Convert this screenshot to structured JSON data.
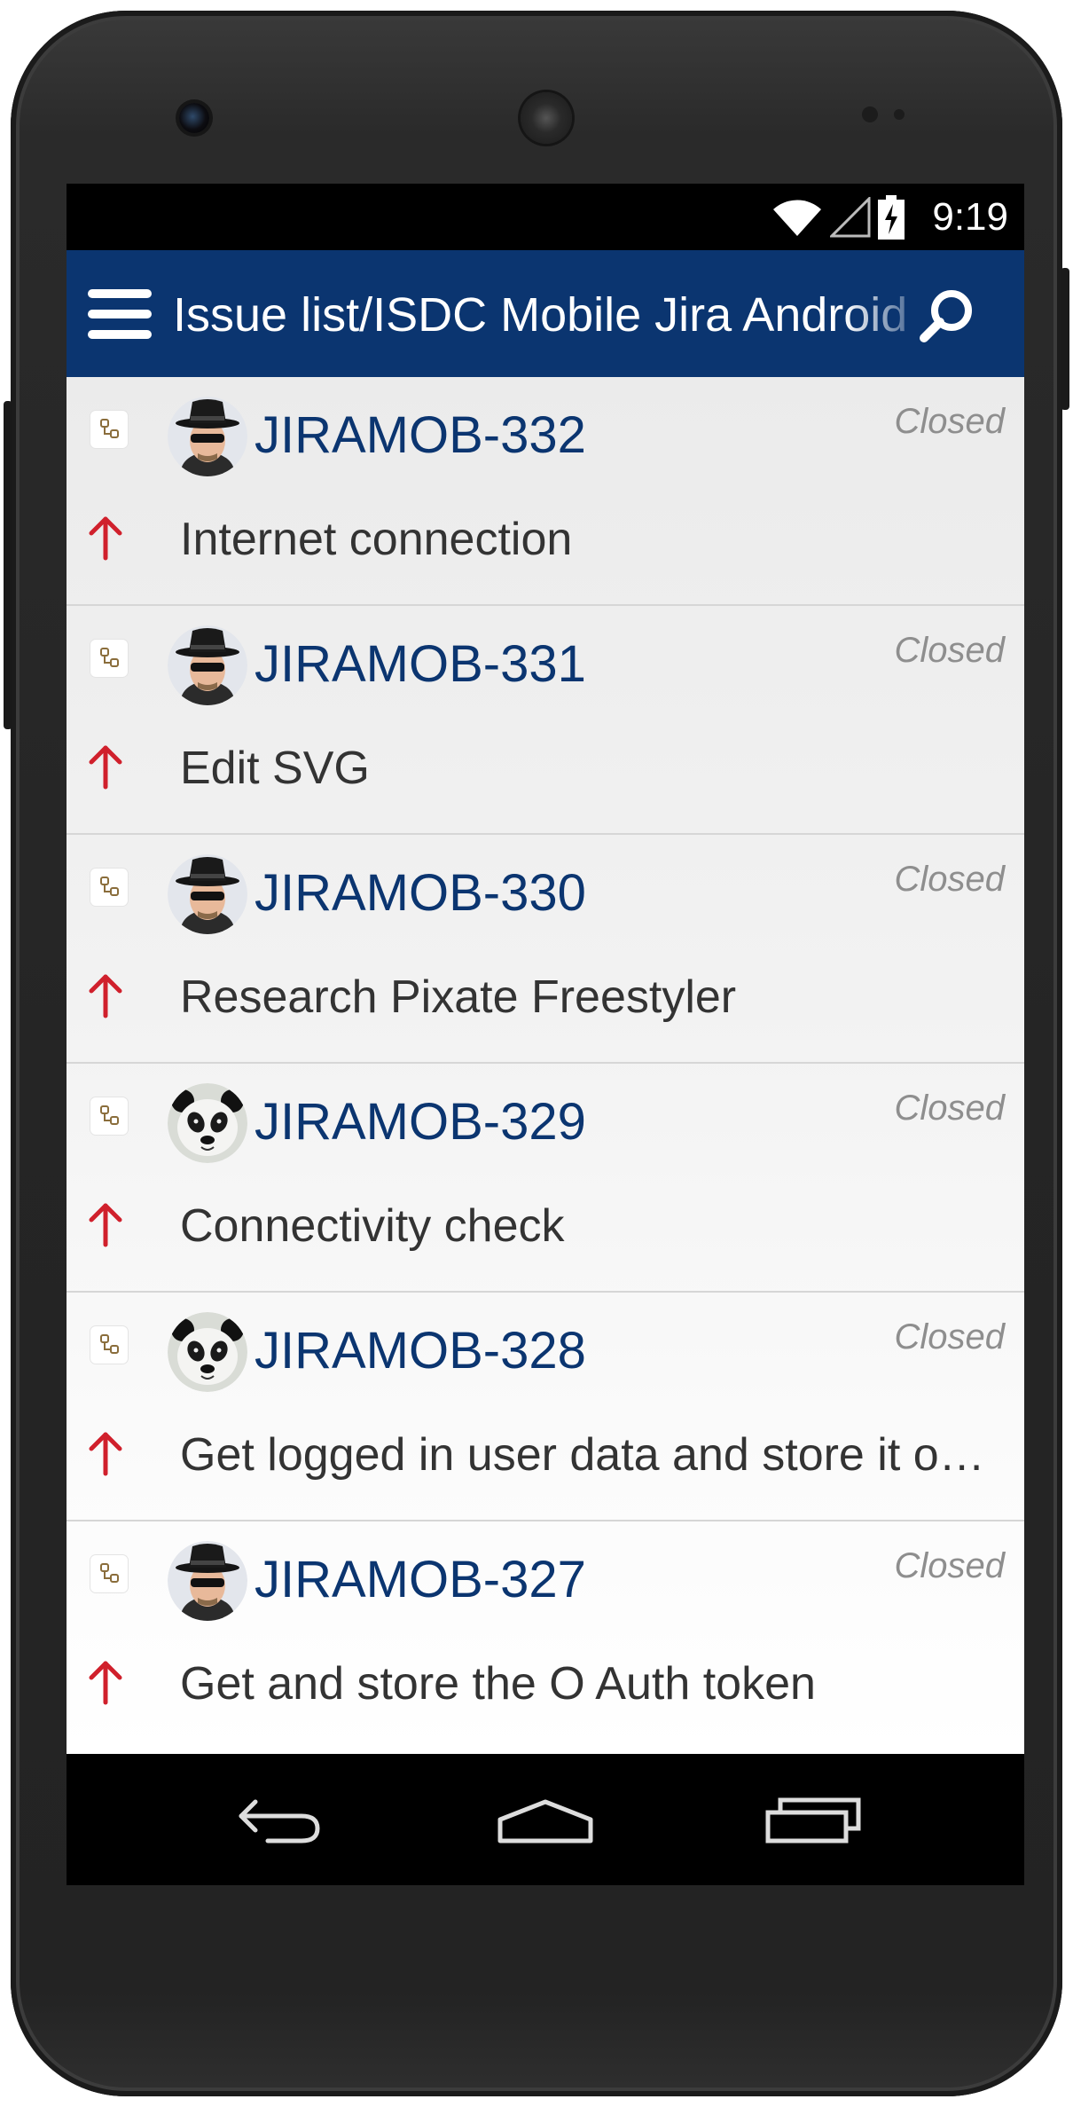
{
  "status_bar": {
    "time": "9:19",
    "icons": [
      "wifi-icon",
      "cell-signal-icon",
      "battery-charging-icon"
    ]
  },
  "app_bar": {
    "title": "Issue list/ISDC Mobile Jira Android",
    "menu_icon": "hamburger-menu-icon",
    "search_icon": "search-icon",
    "background_color": "#0b3570"
  },
  "issues": [
    {
      "key": "JIRAMOB-332",
      "status": "Closed",
      "summary": "Internet connection",
      "avatar": "user-avatar-hat",
      "priority": "major-priority-arrow-icon",
      "type": "subtask-icon"
    },
    {
      "key": "JIRAMOB-331",
      "status": "Closed",
      "summary": "Edit SVG",
      "avatar": "user-avatar-hat",
      "priority": "major-priority-arrow-icon",
      "type": "subtask-icon"
    },
    {
      "key": "JIRAMOB-330",
      "status": "Closed",
      "summary": "Research Pixate Freestyler",
      "avatar": "user-avatar-hat",
      "priority": "major-priority-arrow-icon",
      "type": "subtask-icon"
    },
    {
      "key": "JIRAMOB-329",
      "status": "Closed",
      "summary": "Connectivity check",
      "avatar": "user-avatar-panda",
      "priority": "major-priority-arrow-icon",
      "type": "subtask-icon"
    },
    {
      "key": "JIRAMOB-328",
      "status": "Closed",
      "summary": "Get logged in user data and store it on…",
      "avatar": "user-avatar-panda",
      "priority": "major-priority-arrow-icon",
      "type": "subtask-icon"
    },
    {
      "key": "JIRAMOB-327",
      "status": "Closed",
      "summary": "Get and store the O Auth token",
      "avatar": "user-avatar-hat",
      "priority": "major-priority-arrow-icon",
      "type": "subtask-icon"
    }
  ],
  "nav_bar": {
    "buttons": [
      "back-icon",
      "home-icon",
      "recents-icon"
    ]
  },
  "colors": {
    "issue_key": "#0b3570",
    "priority": "#d0202c",
    "status_text": "#8e8e8e"
  }
}
